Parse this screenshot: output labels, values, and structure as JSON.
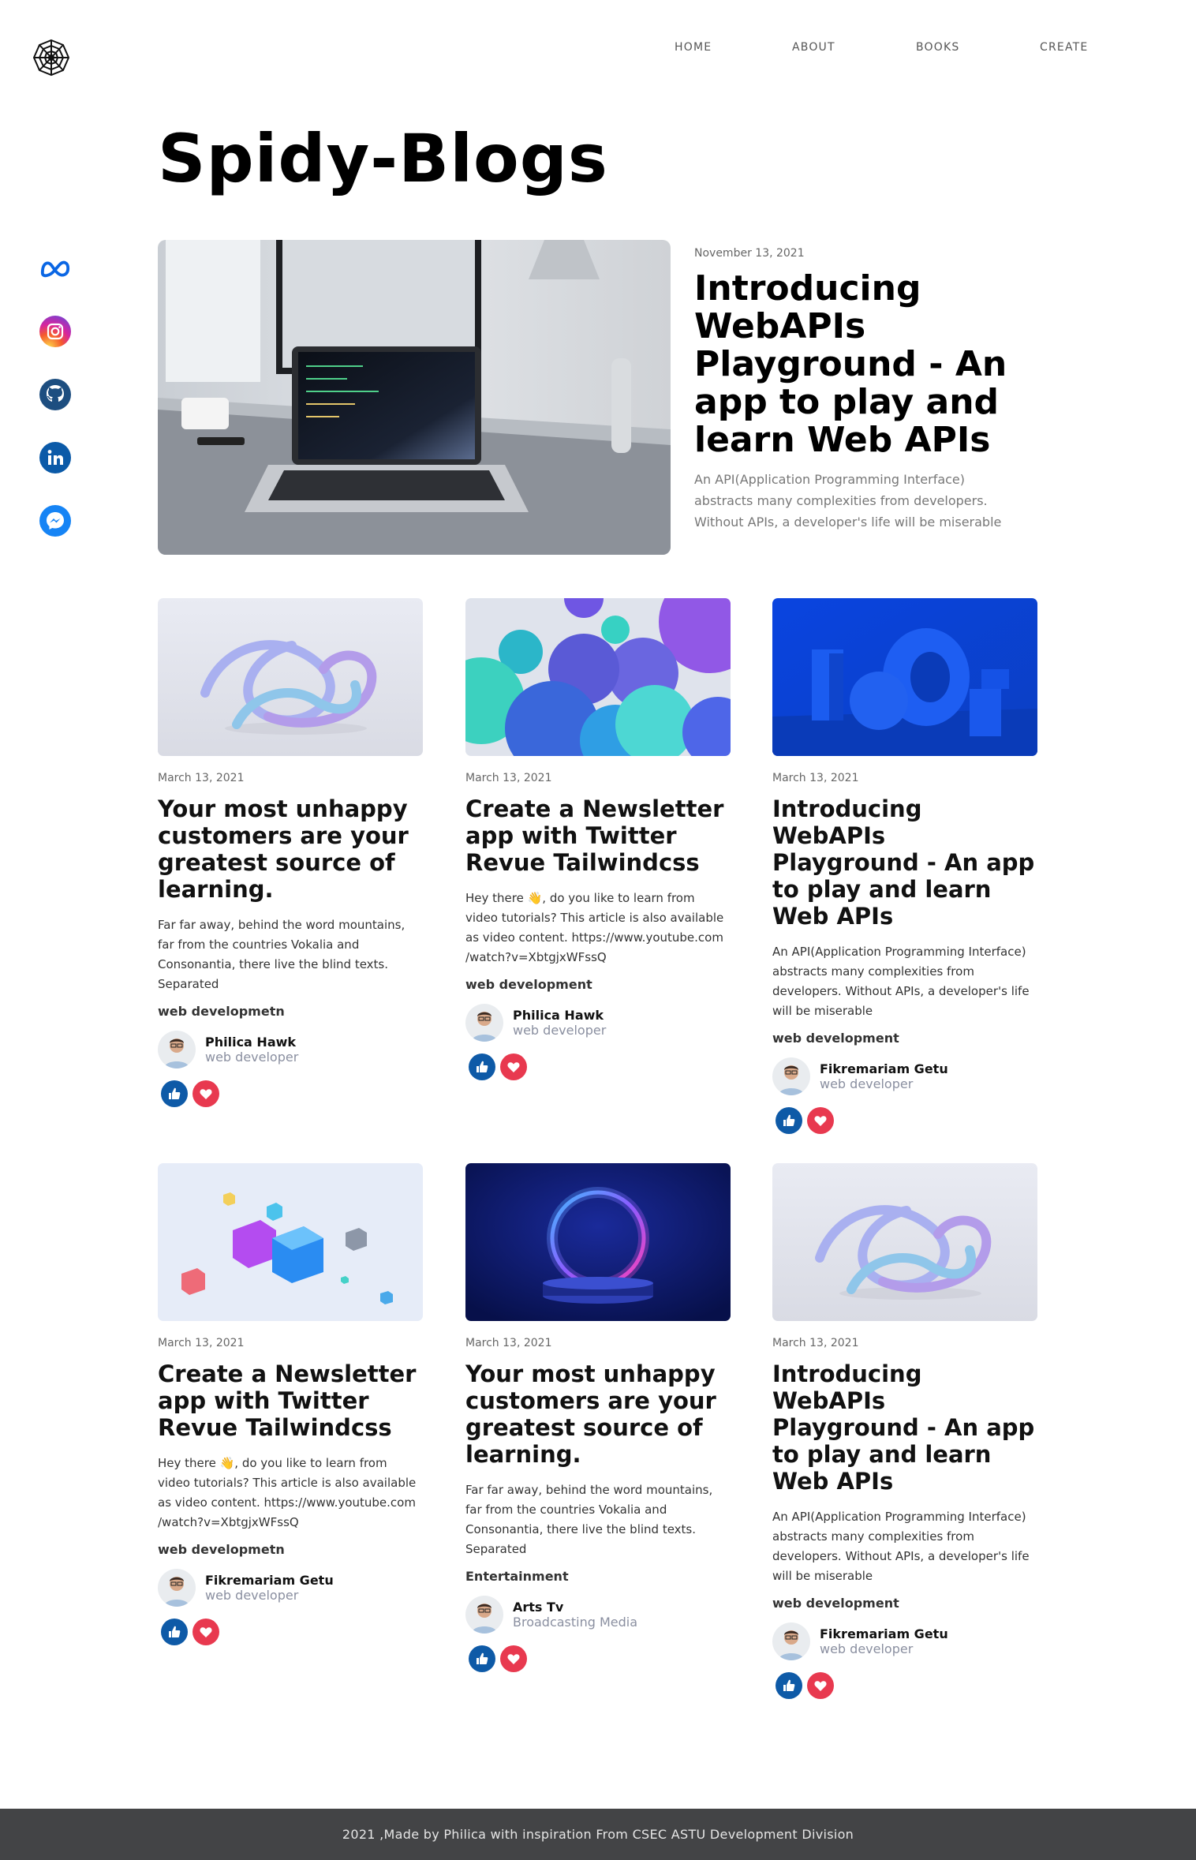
{
  "nav": {
    "home": "HOME",
    "about": "ABOUT",
    "books": "BOOKS",
    "create": "CREATE"
  },
  "social_icons": [
    "meta-icon",
    "instagram-icon",
    "github-icon",
    "linkedin-icon",
    "messenger-icon"
  ],
  "site_title": "Spidy-Blogs",
  "hero": {
    "date": "November 13, 2021",
    "title": "Introducing WebAPIs Playground - An app to play and learn Web APIs",
    "description": "An API(Application Programming Interface) abstracts many complexities from developers. Without APIs, a developer's life will be miserable"
  },
  "cards": [
    {
      "date": "March 13, 2021",
      "title": "Your most unhappy customers are your greatest source of learning.",
      "description": "Far far away, behind the word mountains, far from the countries Vokalia and Consonantia, there live the blind texts. Separated",
      "category": "web developmetn",
      "author": "Philica Hawk",
      "role": "web developer"
    },
    {
      "date": "March 13, 2021",
      "title": "Create a Newsletter app with Twitter Revue Tailwindcss",
      "description": "Hey there 👋, do you like to learn from video tutorials? This article is also available as video content. https://www.youtube.com /watch?v=XbtgjxWFssQ",
      "category": "web development",
      "author": "Philica Hawk",
      "role": "web developer"
    },
    {
      "date": "March 13, 2021",
      "title": "Introducing WebAPIs Playground - An app to play and learn Web APIs",
      "description": "An API(Application Programming Interface) abstracts many complexities from developers. Without APIs, a developer's life will be miserable",
      "category": "web development",
      "author": "Fikremariam Getu",
      "role": "web developer"
    },
    {
      "date": "March 13, 2021",
      "title": "Create a Newsletter app with Twitter Revue Tailwindcss",
      "description": "Hey there 👋, do you like to learn from video tutorials? This article is also available as video content. https://www.youtube.com /watch?v=XbtgjxWFssQ",
      "category": "web developmetn",
      "author": "Fikremariam Getu",
      "role": "web developer"
    },
    {
      "date": "March 13, 2021",
      "title": "Your most unhappy customers are your greatest source of learning.",
      "description": "Far far away, behind the word mountains, far from the countries Vokalia and Consonantia, there live the blind texts. Separated",
      "category": "Entertainment",
      "author": "Arts Tv",
      "role": "Broadcasting Media"
    },
    {
      "date": "March 13, 2021",
      "title": "Introducing WebAPIs Playground - An app to play and learn Web APIs",
      "description": "An API(Application Programming Interface) abstracts many complexities from developers. Without APIs, a developer's life will be miserable",
      "category": "web development",
      "author": "Fikremariam Getu",
      "role": "web developer"
    }
  ],
  "colors": {
    "like": "#0e5aa7",
    "love": "#e8394f",
    "footer_bg": "#434446"
  },
  "footer": "2021 ,Made by Philica with inspiration From CSEC ASTU Development Division"
}
